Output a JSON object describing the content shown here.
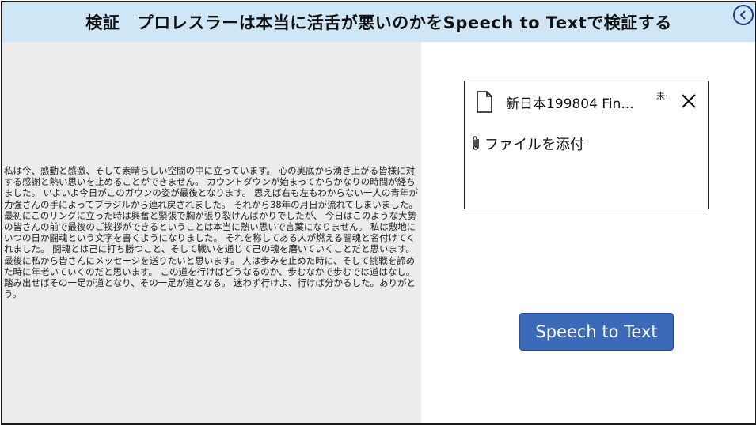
{
  "header": {
    "title": "検証　プロレスラーは本当に活舌が悪いのかをSpeech to Textで検証する",
    "back_icon": "chevron-left-icon"
  },
  "transcript": {
    "text": "私は今、感動と感激、そして素晴らしい空間の中に立っています。 心の奥底から湧き上がる皆様に対する感謝と熱い思いを止めることができません。 カウントダウンが始まってからかなりの時間が経ちました。 いよいよ今日がこのガウンの姿が最後となります。 思えば右も左もわからない一人の青年が力強さんの手によってブラジルから連れ戻されました。 それから38年の月日が流れてしまいました。 最初にこのリングに立った時は興奮と緊張で胸が張り裂けんばかりでしたが、 今日はこのような大勢の皆さんの前で最後のご挨拶ができるということは本当に熱い思いで言葉になりません。 私は敷地にいつの日か闘魂という文字を書くようになりました。 それを称してある人が燃える闘魂と名付けてくれました。 闘魂とは己に打ち勝つこと、そして戦いを通じて己の魂を磨いていくことだと思います。 最後に私から皆さんにメッセージを送りたいと思います。 人は歩みを止めた時に、そして挑戦を諦めた時に年老いていくのだと思います。 この道を行けばどうなるのか、歩むなかで歩むでは道はなし。 踏み出せばその一足が道となり、その一足が道となる。 迷わず行けよ、行けば分かるした。ありがとう。"
  },
  "attachments": {
    "file_name": "新日本199804 Fin...",
    "file_status": "未·",
    "add_label": "ファイルを添付",
    "file_icon": "file-icon",
    "remove_icon": "close-icon",
    "clip_icon": "paperclip-icon"
  },
  "actions": {
    "speech_to_text_label": "Speech to Text"
  },
  "colors": {
    "header_bg": "#cfe6f6",
    "left_panel_bg": "#ececec",
    "button_bg": "#3a6ab8",
    "back_icon": "#1f3d8a"
  }
}
